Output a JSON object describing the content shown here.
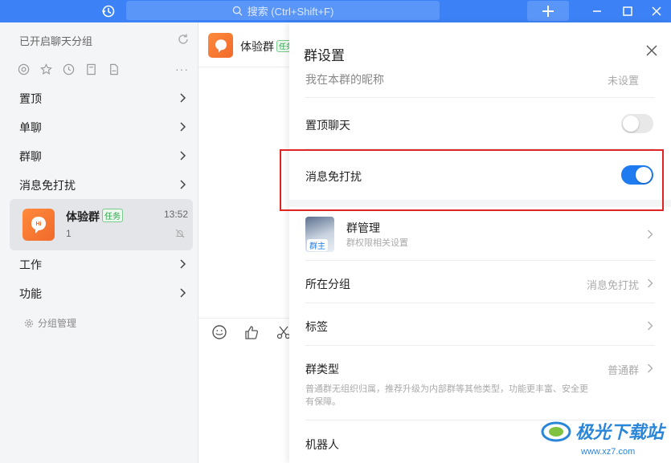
{
  "titlebar": {
    "search_placeholder": "搜索 (Ctrl+Shift+F)",
    "accent_color": "#3c82f6",
    "icons": [
      "history-icon",
      "search-icon",
      "plus-icon",
      "minimize-icon",
      "maximize-icon",
      "close-icon"
    ]
  },
  "sidebar": {
    "header": "已开启聊天分组",
    "filter_icons": [
      "at-icon",
      "star-icon",
      "clock-icon",
      "bookmark-icon",
      "file-icon"
    ],
    "groups": [
      {
        "label": "置顶"
      },
      {
        "label": "单聊"
      },
      {
        "label": "群聊"
      },
      {
        "label": "消息免打扰"
      }
    ],
    "chat": {
      "name": "体验群",
      "badge": "任务",
      "time": "13:52",
      "preview": "1"
    },
    "groups_after": [
      {
        "label": "工作"
      },
      {
        "label": "功能"
      }
    ],
    "group_manage": "分组管理"
  },
  "chat_area": {
    "title": "体验群",
    "badge": "任务",
    "tools": [
      "emoji-icon",
      "thumbs-up-icon",
      "scissors-icon"
    ]
  },
  "panel": {
    "title": "群设置",
    "partial_row": {
      "label": "我在本群的昵称",
      "value": "未设置"
    },
    "pin_chat": {
      "label": "置顶聊天",
      "enabled": false
    },
    "do_not_disturb": {
      "label": "消息免打扰",
      "enabled": true
    },
    "group_manage": {
      "label": "群管理",
      "desc": "群权限相关设置",
      "owner_tag": "群主"
    },
    "group_folder": {
      "label": "所在分组",
      "value": "消息免打扰"
    },
    "tags": {
      "label": "标签"
    },
    "group_type": {
      "label": "群类型",
      "value": "普通群",
      "desc": "普通群无组织归属，推荐升级为内部群等其他类型，功能更丰富、安全更有保障。"
    },
    "robot": {
      "label": "机器人"
    },
    "toggle_on_color": "#1e7cf0",
    "highlight_color": "#e02424"
  },
  "watermark": {
    "text": "极光下载站",
    "url": "www.xz7.com"
  }
}
